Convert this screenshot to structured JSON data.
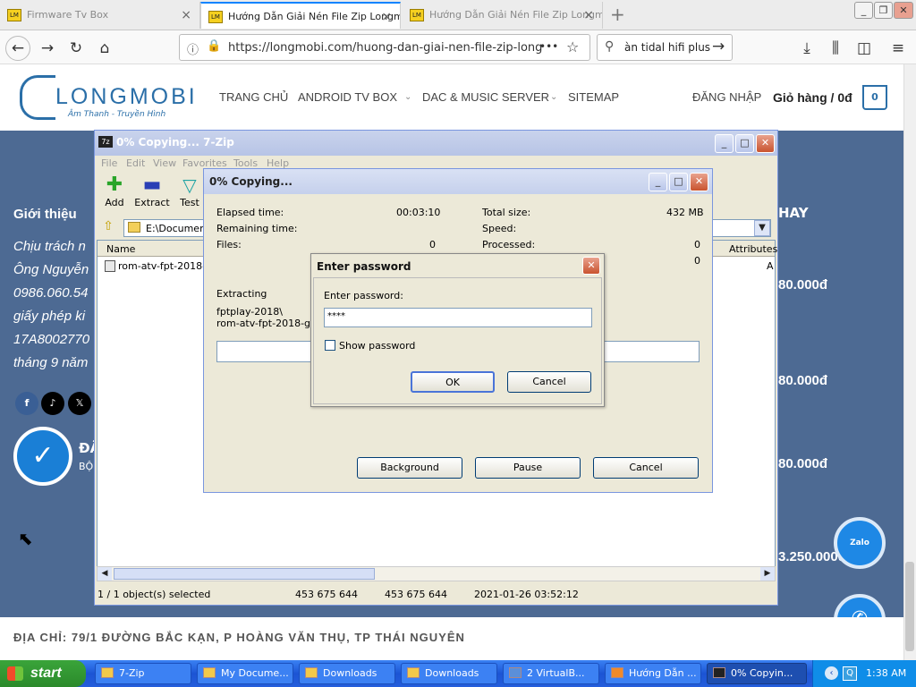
{
  "browser": {
    "tabs": [
      {
        "title": "Firmware Tv Box",
        "active": false
      },
      {
        "title": "Hướng Dẫn Giải Nén File Zip Longmobi",
        "active": true
      },
      {
        "title": "Hướng Dẫn Giải Nén File Zip Longmobi",
        "active": false
      }
    ],
    "url": "https://longmobi.com/huong-dan-giai-nen-file-zip-long",
    "search_text": "àn tidal hifi plus",
    "more_glyph": "•••"
  },
  "site": {
    "logo_text": "LONGMOBI",
    "logo_sub": "Âm Thanh - Truyền Hình",
    "menu": [
      "TRANG CHỦ",
      "ANDROID TV BOX",
      "DAC & MUSIC SERVER",
      "SITEMAP"
    ],
    "login": "ĐĂNG NHẬP",
    "cart": "Giỏ hàng / 0đ",
    "cart_count": "0",
    "intro_heading": "Giới thiệu",
    "intro_lines": [
      "Chịu trách n",
      "Ông Nguyễn",
      "0986.060.54",
      "giấy phép ki",
      "17A8002770",
      "tháng 9 năm"
    ],
    "side_heading": "HAY",
    "prices": [
      "80.000đ",
      "80.000đ",
      "80.000đ",
      "3.250.000đ"
    ],
    "address": "ĐỊA CHỈ: 79/1 ĐƯỜNG BẮC KẠN, P HOÀNG VĂN THỤ, TP THÁI NGUYÊN",
    "badge_text": "ĐÃ",
    "badge_sub": "BỘ",
    "zalo": "Zalo"
  },
  "zip": {
    "title": "0% Copying... 7-Zip",
    "menu": [
      "File",
      "Edit",
      "View",
      "Favorites",
      "Tools",
      "Help"
    ],
    "tools": [
      "Add",
      "Extract",
      "Test"
    ],
    "path": "E:\\Documents",
    "col_name": "Name",
    "col_attr": "Attributes",
    "file": "rom-atv-fpt-2018-gi",
    "attr": "A",
    "status": [
      "1 / 1 object(s) selected",
      "453 675 644",
      "453 675 644",
      "2021-01-26 03:52:12"
    ]
  },
  "progress": {
    "title": "0% Copying...",
    "elapsed_label": "Elapsed time:",
    "elapsed": "00:03:10",
    "remaining_label": "Remaining time:",
    "files_label": "Files:",
    "files": "0",
    "total_label": "Total size:",
    "total": "432 MB",
    "speed_label": "Speed:",
    "processed_label": "Processed:",
    "processed": "0",
    "extra": "0",
    "extracting": "Extracting",
    "path1": "fptplay-2018\\",
    "path2": "rom-atv-fpt-2018-giai-n",
    "buttons": [
      "Background",
      "Pause",
      "Cancel"
    ]
  },
  "password": {
    "title": "Enter password",
    "label": "Enter password:",
    "value": "****",
    "show": "Show password",
    "ok": "OK",
    "cancel": "Cancel"
  },
  "taskbar": {
    "start": "start",
    "items": [
      "7-Zip",
      "My Docume...",
      "Downloads",
      "Downloads",
      "2 VirtualB...",
      "Hướng Dẫn ...",
      "0% Copyin..."
    ],
    "clock": "1:38 AM"
  }
}
